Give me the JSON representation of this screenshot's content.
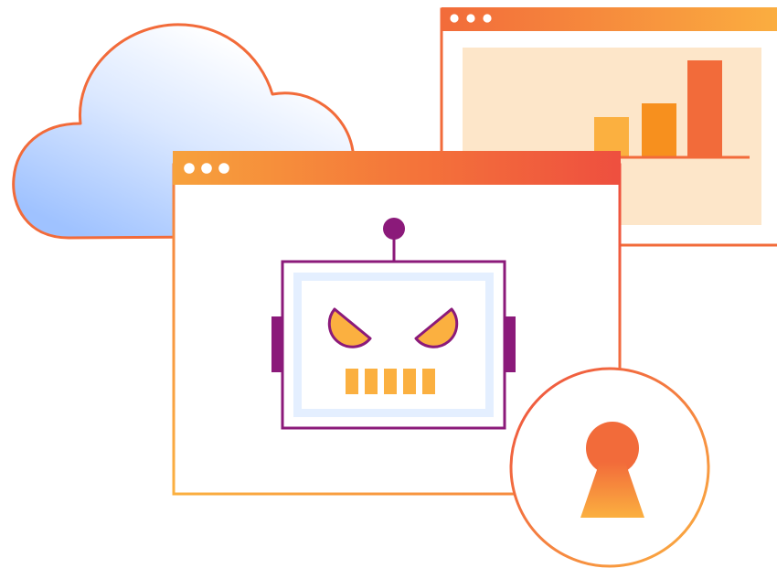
{
  "illustration": {
    "elements": [
      "cloud",
      "back-browser-window",
      "bar-chart",
      "front-browser-window",
      "angry-robot",
      "keyhole-lock-badge"
    ],
    "bar_chart": {
      "values": [
        1,
        1.4,
        2.5
      ]
    },
    "colors": {
      "orange": "#f26b3a",
      "light-orange": "#fbb040",
      "peach": "#fde6c9",
      "purple": "#8b1a7a",
      "cloud-blue": "#a9c8ff",
      "robot-screen": "#e4efff",
      "white": "#ffffff"
    }
  }
}
